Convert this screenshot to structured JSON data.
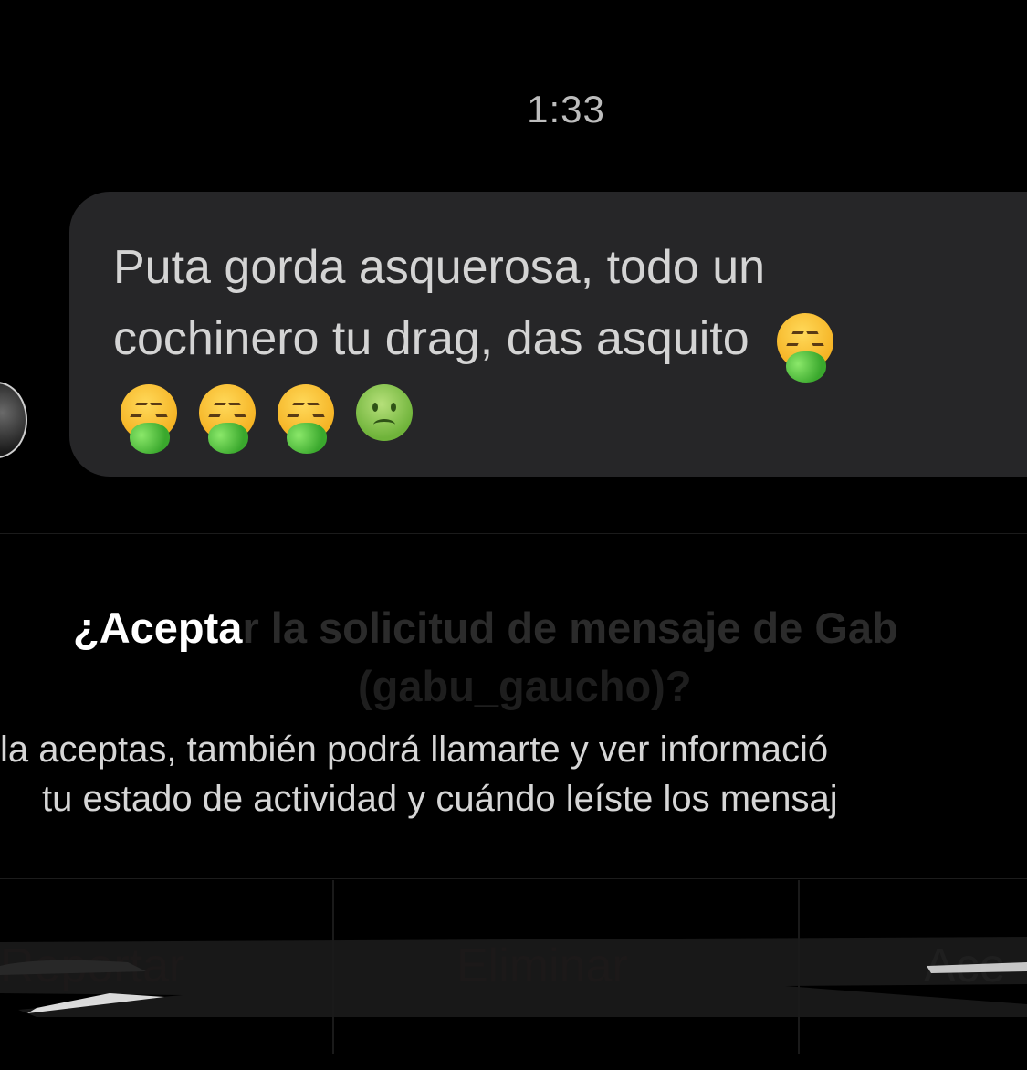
{
  "header": {
    "time": "1:33"
  },
  "message": {
    "text": "Puta gorda asquerosa, todo un\ncochinero tu drag, das asquito",
    "emojis": [
      "face-vomiting-icon",
      "face-vomiting-icon",
      "face-vomiting-icon",
      "face-vomiting-icon",
      "nauseated-face-icon"
    ]
  },
  "request": {
    "title_visible": "¿Aceptar la solicitud de mensaje de Gab",
    "title_prefix": "¿Acepta",
    "title_rest": "r la solicitud de mensaje de Gab",
    "handle": "(gabu_gaucho)?",
    "description_line1": "la aceptas, también podrá llamarte y ver informació",
    "description_line2": "tu estado de actividad y cuándo leíste los mensaj"
  },
  "actions": {
    "report_label": "Reportar",
    "delete_label": "Eliminar",
    "accept_label": "Ace"
  },
  "colors": {
    "bubble": "#262628",
    "background": "#000000",
    "danger": "#ed4956"
  }
}
